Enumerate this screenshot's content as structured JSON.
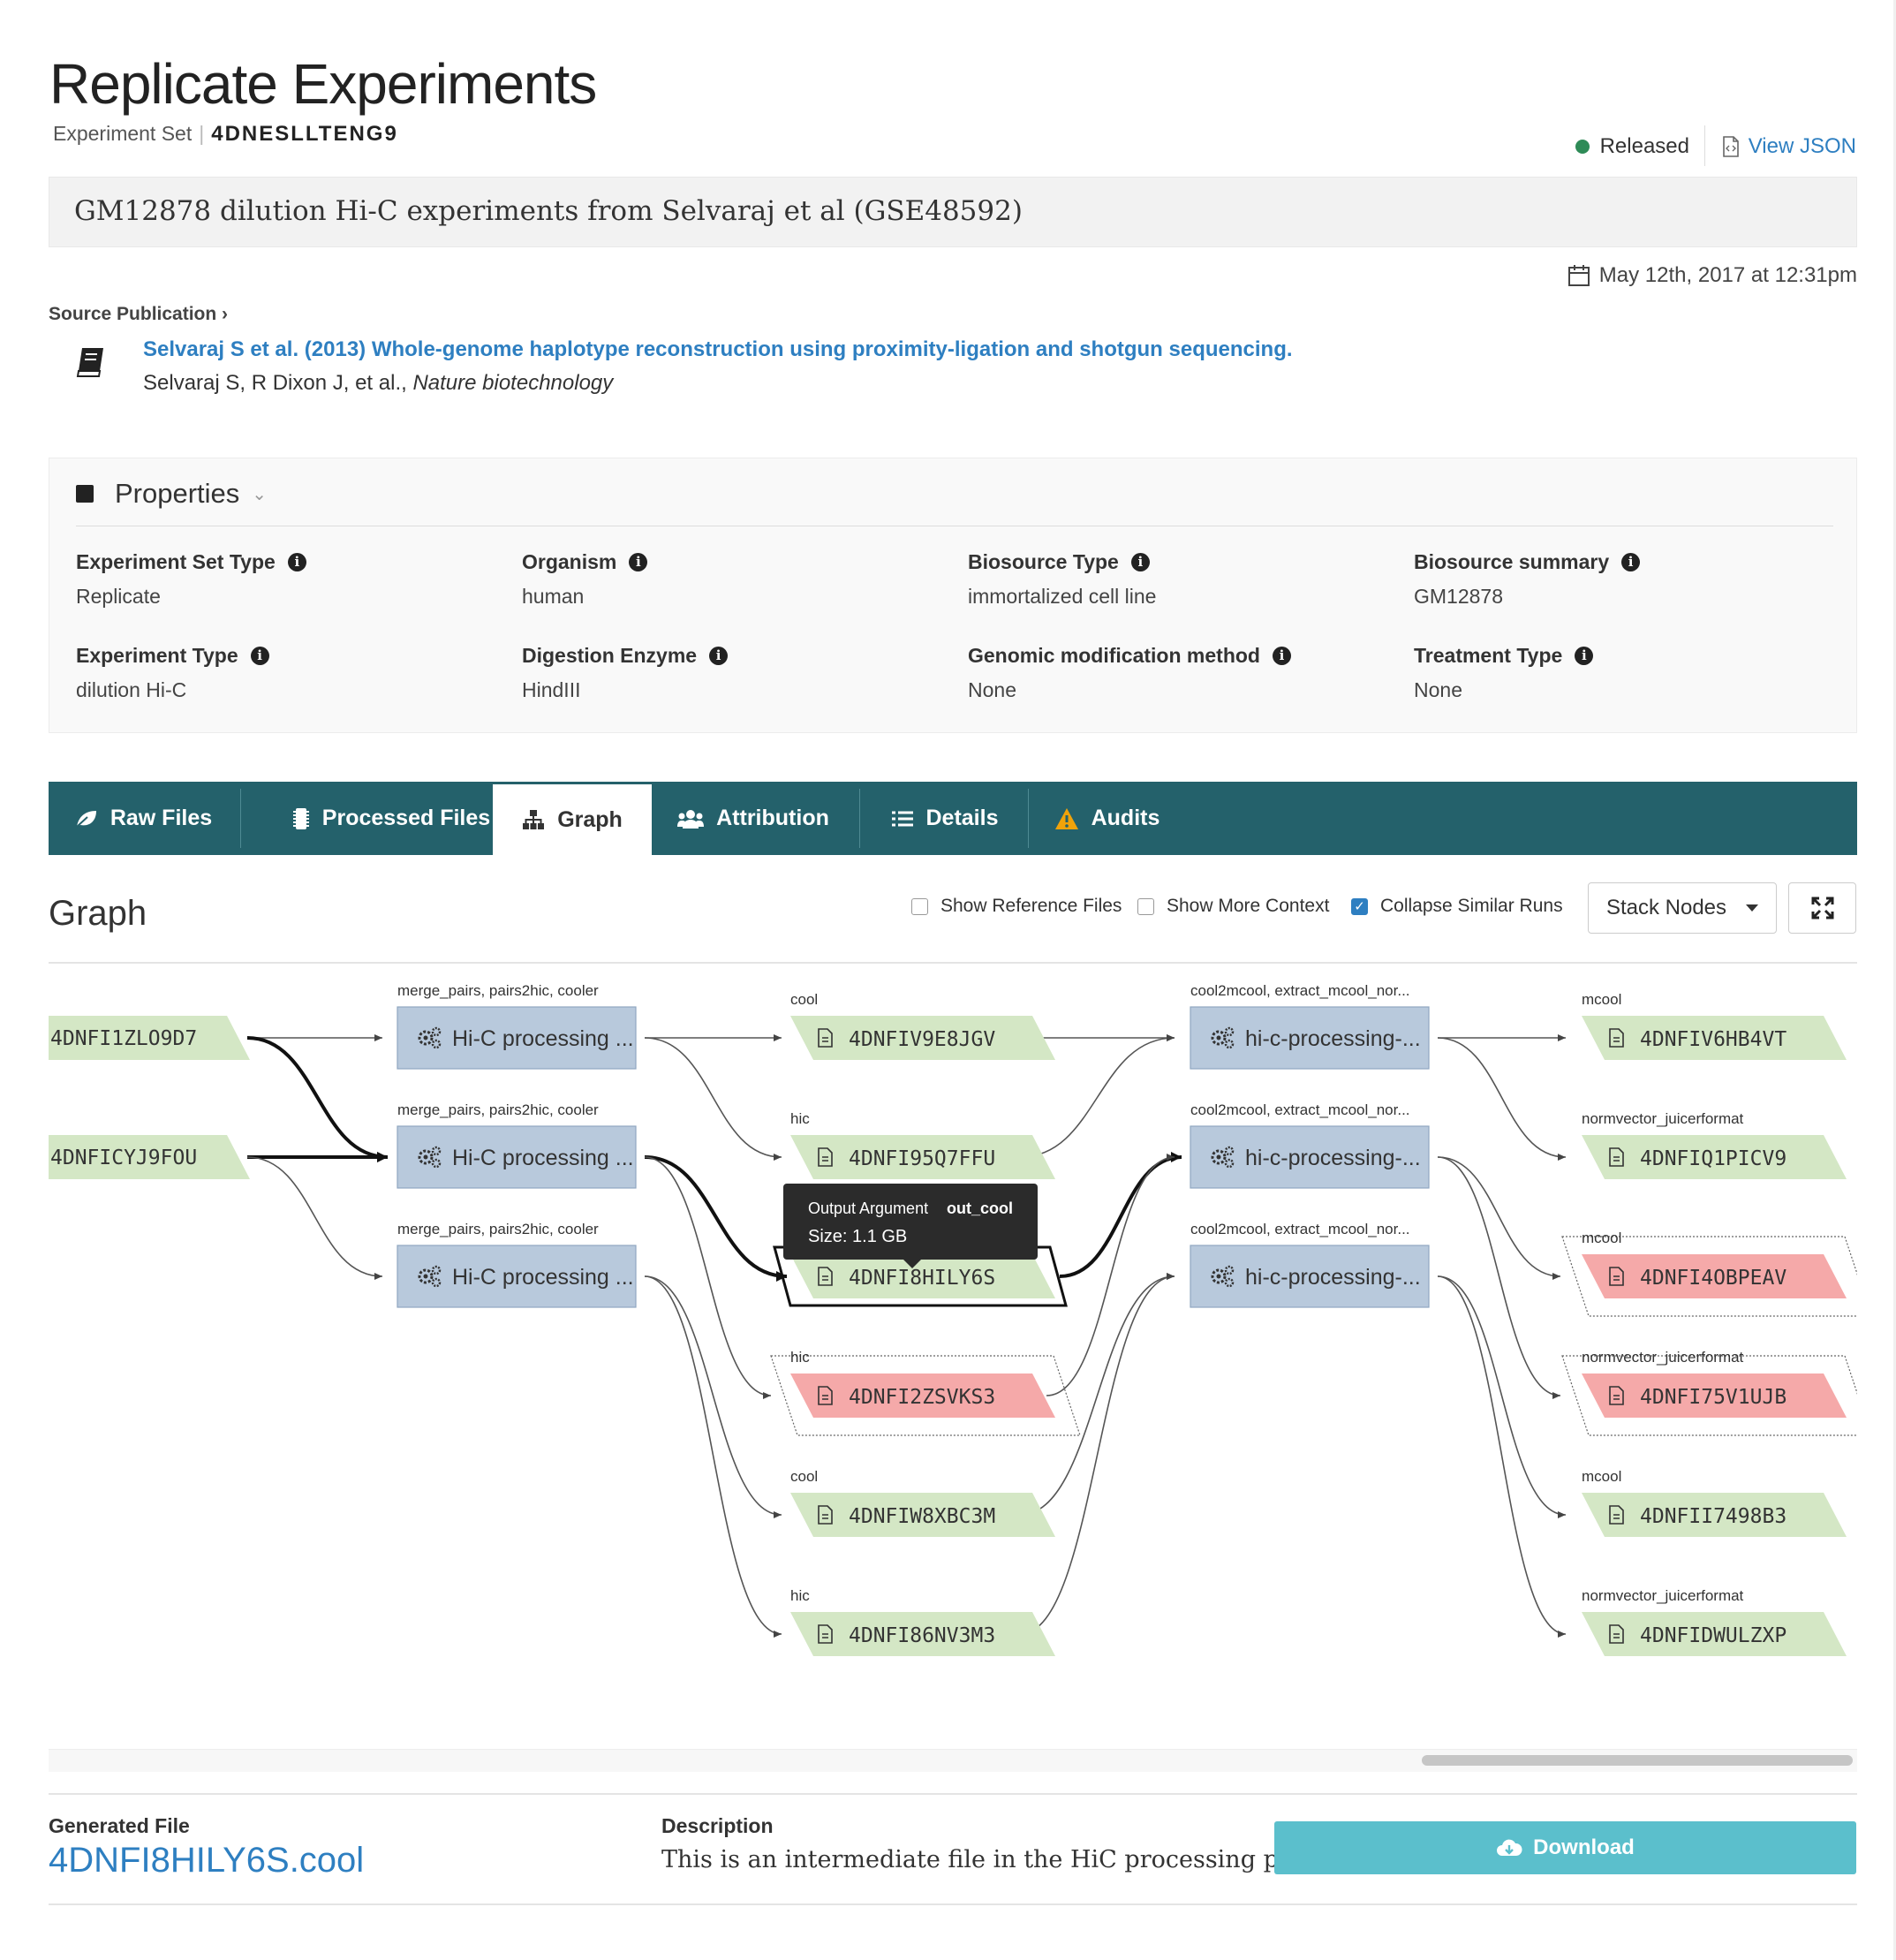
{
  "header": {
    "title": "Replicate Experiments",
    "subtitle_label": "Experiment Set",
    "accession": "4DNESLLTENG9",
    "status": "Released",
    "view_json": "View JSON",
    "description": "GM12878 dilution Hi-C experiments from Selvaraj et al (GSE48592)",
    "date": "May 12th, 2017 at 12:31pm",
    "status_color": "#2e8b57"
  },
  "publication": {
    "section_label": "Source Publication",
    "title": "Selvaraj S et al. (2013) Whole-genome haplotype reconstruction using proximity-ligation and shotgun sequencing.",
    "authors": "Selvaraj S, R Dixon J, et al., ",
    "journal": "Nature biotechnology"
  },
  "properties": {
    "heading": "Properties",
    "items": [
      {
        "label": "Experiment Set Type",
        "value": "Replicate",
        "link": false
      },
      {
        "label": "Organism",
        "value": "human",
        "link": true
      },
      {
        "label": "Biosource Type",
        "value": "immortalized cell line",
        "link": false
      },
      {
        "label": "Biosource summary",
        "value": "GM12878",
        "link": false
      },
      {
        "label": "Experiment Type",
        "value": "dilution Hi-C",
        "link": false
      },
      {
        "label": "Digestion Enzyme",
        "value": "HindIII",
        "link": true
      },
      {
        "label": "Genomic modification method",
        "value": "None",
        "link": false
      },
      {
        "label": "Treatment Type",
        "value": "None",
        "link": false
      }
    ]
  },
  "tabs": [
    {
      "label": "Raw Files",
      "icon": "leaf-icon"
    },
    {
      "label": "Processed Files",
      "icon": "microchip-icon"
    },
    {
      "label": "Graph",
      "icon": "sitemap-icon",
      "active": true
    },
    {
      "label": "Attribution",
      "icon": "users-icon"
    },
    {
      "label": "Details",
      "icon": "list-icon"
    },
    {
      "label": "Audits",
      "icon": "warning-icon"
    }
  ],
  "graph": {
    "heading": "Graph",
    "options": [
      {
        "label": "Show Reference Files",
        "checked": false
      },
      {
        "label": "Show More Context",
        "checked": false
      },
      {
        "label": "Collapse Similar Runs",
        "checked": true
      }
    ],
    "stack_button": "Stack Nodes",
    "colors": {
      "file": "#d4e7c5",
      "file_error": "#f5a9a9",
      "step": "#b8c9dc",
      "step_border": "#8fa6c0"
    },
    "input_files": [
      "4DNFI1ZLO9D7",
      "4DNFICYJ9FOU"
    ],
    "steps_col1": [
      {
        "title": "merge_pairs, pairs2hic, cooler",
        "label": "Hi-C processing ..."
      },
      {
        "title": "merge_pairs, pairs2hic, cooler",
        "label": "Hi-C processing ..."
      },
      {
        "title": "merge_pairs, pairs2hic, cooler",
        "label": "Hi-C processing ..."
      }
    ],
    "mid_files": [
      {
        "format": "cool",
        "name": "4DNFIV9E8JGV",
        "status": "ok"
      },
      {
        "format": "hic",
        "name": "4DNFI95Q7FFU",
        "status": "ok"
      },
      {
        "format": "cool",
        "name": "4DNFI8HILY6S",
        "status": "selected"
      },
      {
        "format": "hic",
        "name": "4DNFI2ZSVKS3",
        "status": "error"
      },
      {
        "format": "cool",
        "name": "4DNFIW8XBC3M",
        "status": "ok"
      },
      {
        "format": "hic",
        "name": "4DNFI86NV3M3",
        "status": "ok"
      }
    ],
    "steps_col2": [
      {
        "title": "cool2mcool, extract_mcool_nor...",
        "label": "hi-c-processing-..."
      },
      {
        "title": "cool2mcool, extract_mcool_nor...",
        "label": "hi-c-processing-..."
      },
      {
        "title": "cool2mcool, extract_mcool_nor...",
        "label": "hi-c-processing-..."
      }
    ],
    "out_files": [
      {
        "format": "mcool",
        "name": "4DNFIV6HB4VT",
        "status": "ok"
      },
      {
        "format": "normvector_juicerformat",
        "name": "4DNFIQ1PICV9",
        "status": "ok"
      },
      {
        "format": "mcool",
        "name": "4DNFI4OBPEAV",
        "status": "error"
      },
      {
        "format": "normvector_juicerformat",
        "name": "4DNFI75V1UJB",
        "status": "error"
      },
      {
        "format": "mcool",
        "name": "4DNFII7498B3",
        "status": "ok"
      },
      {
        "format": "normvector_juicerformat",
        "name": "4DNFIDWULZXP",
        "status": "ok"
      }
    ],
    "tooltip": {
      "arg_label": "Output Argument",
      "arg_value": "out_cool",
      "size": "Size: 1.1 GB"
    }
  },
  "footer": {
    "generated_label": "Generated File",
    "generated_value": "4DNFI8HILY6S.cool",
    "description_label": "Description",
    "description_value": "This is an intermediate file in the HiC processing pi...",
    "download_label": "Download"
  }
}
